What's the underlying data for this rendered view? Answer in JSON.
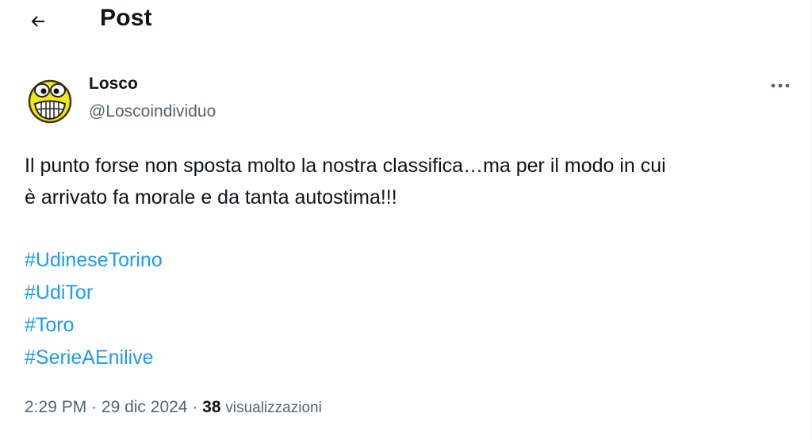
{
  "header": {
    "back_icon": "arrow-left-icon",
    "title": "Post"
  },
  "post": {
    "author": {
      "name": "Losco",
      "handle": "@Loscoindividuo",
      "avatar_icon": "grinning-face-avatar"
    },
    "more_icon": "more-horizontal-icon",
    "text_line1": "Il punto forse non sposta molto la nostra classifica…ma per il modo in cui",
    "text_line2": "è arrivato fa morale e da tanta autostima!!!",
    "hashtags": [
      "#UdineseTorino",
      "#UdiTor",
      "#Toro",
      "#SerieAEnilive"
    ],
    "time": "2:29 PM",
    "date": "29 dic 2024",
    "separator": " · ",
    "views_count": "38",
    "views_label": "visualizzazioni"
  },
  "colors": {
    "text": "#0f1419",
    "secondary": "#536471",
    "link": "#1d9bf0"
  }
}
